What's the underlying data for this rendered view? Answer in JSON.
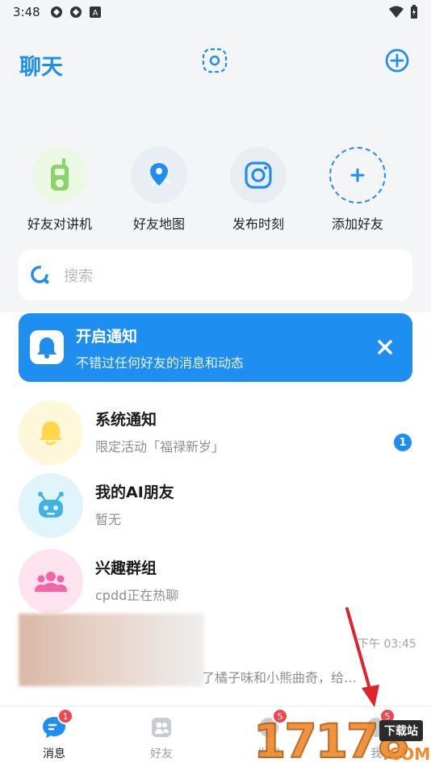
{
  "status_bar": {
    "time": "3:48"
  },
  "header": {
    "title": "聊天"
  },
  "shortcuts": [
    {
      "label": "好友对讲机",
      "icon": "walkie-talkie-icon"
    },
    {
      "label": "好友地图",
      "icon": "map-pin-icon"
    },
    {
      "label": "发布时刻",
      "icon": "camera-icon"
    },
    {
      "label": "添加好友",
      "icon": "plus-icon"
    }
  ],
  "search": {
    "placeholder": "搜索"
  },
  "notify_banner": {
    "title": "开启通知",
    "subtitle": "不错过任何好友的消息和动态"
  },
  "chats": [
    {
      "name": "系统通知",
      "preview": "限定活动「福禄新岁」",
      "badge": "1"
    },
    {
      "name": "我的AI朋友",
      "preview": "暂无"
    },
    {
      "name": "兴趣群组",
      "preview": "cpdd正在热聊"
    },
    {
      "name": "",
      "preview": "了橘子味和小熊曲奇，给…",
      "time": "下午 03:45"
    }
  ],
  "tabs": [
    {
      "label": "消息",
      "badge": "1",
      "active": true
    },
    {
      "label": "好友"
    },
    {
      "label": "发现",
      "badge": "5"
    },
    {
      "label": "我",
      "badge": "5"
    }
  ],
  "watermark": {
    "number": "17178",
    "tag": "下载站",
    "suffix": ".COM"
  },
  "colors": {
    "accent": "#1f8ef1",
    "badge_red": "#f2454d",
    "annotation_arrow": "#e0232b"
  }
}
